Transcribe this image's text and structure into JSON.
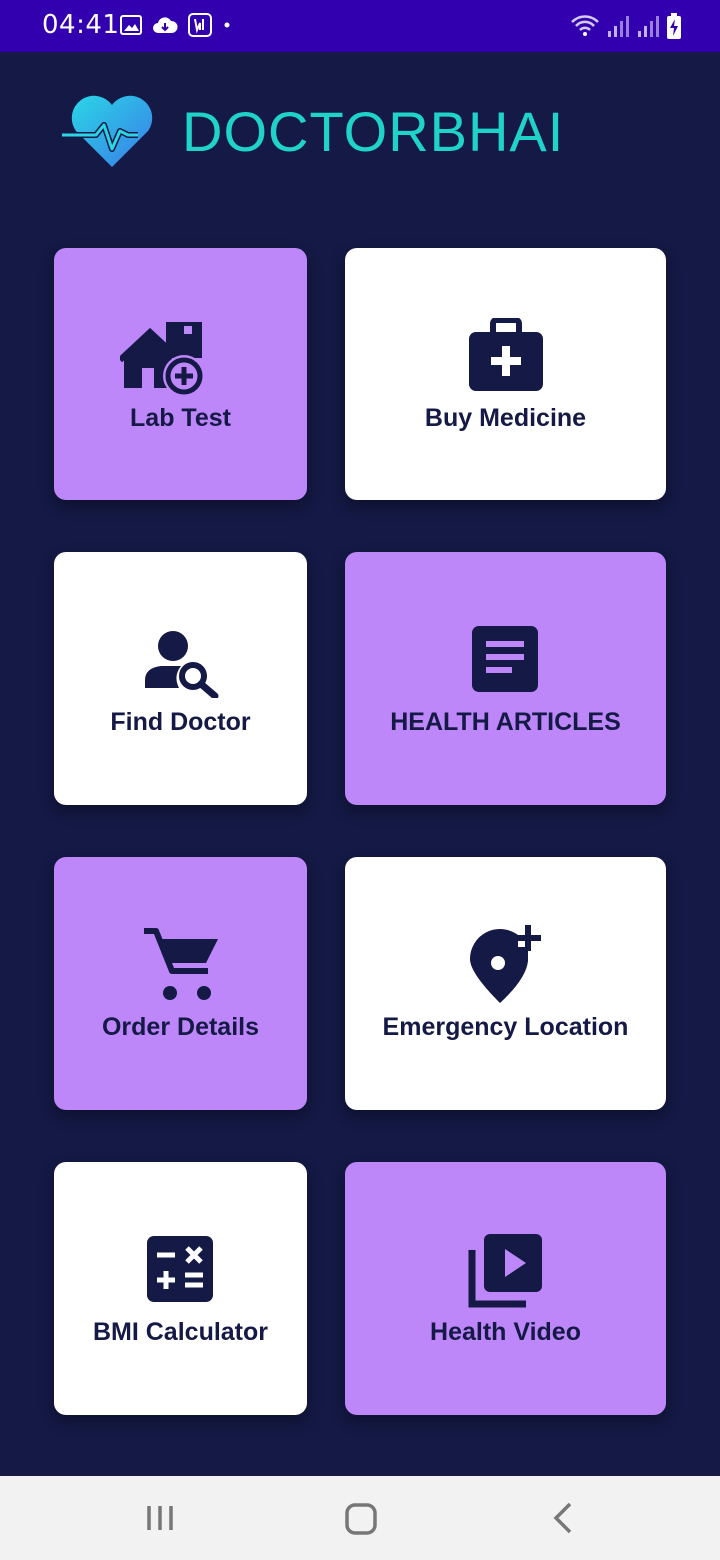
{
  "status_bar": {
    "time": "04:41",
    "left_icons": [
      "image-icon",
      "cloud-download-icon",
      "voicemail-icon",
      "dot-icon"
    ],
    "right_icons": [
      "wifi-icon",
      "signal-icon",
      "signal-icon",
      "battery-charging-icon"
    ]
  },
  "header": {
    "app_title": "DOCTORBHAI",
    "logo_icon": "heart-pulse-icon"
  },
  "tiles": [
    {
      "label": "Lab Test",
      "icon": "home-add-icon",
      "color": "purple"
    },
    {
      "label": "Buy Medicine",
      "icon": "medical-bag-icon",
      "color": "white"
    },
    {
      "label": "Find Doctor",
      "icon": "person-search-icon",
      "color": "white"
    },
    {
      "label": "HEALTH ARTICLES",
      "icon": "article-icon",
      "color": "purple"
    },
    {
      "label": "Order Details",
      "icon": "cart-icon",
      "color": "purple"
    },
    {
      "label": "Emergency Location",
      "icon": "location-add-icon",
      "color": "white"
    },
    {
      "label": "BMI Calculator",
      "icon": "calculator-icon",
      "color": "white"
    },
    {
      "label": "Health Video",
      "icon": "video-library-icon",
      "color": "purple"
    }
  ],
  "colors": {
    "background": "#141945",
    "status_bar": "#3300b0",
    "accent": "#1fd3c8",
    "tile_purple": "#bd87f9",
    "tile_white": "#ffffff",
    "icon_dark": "#141945"
  },
  "nav_bar": {
    "buttons": [
      "recents-icon",
      "home-icon",
      "back-icon"
    ]
  }
}
